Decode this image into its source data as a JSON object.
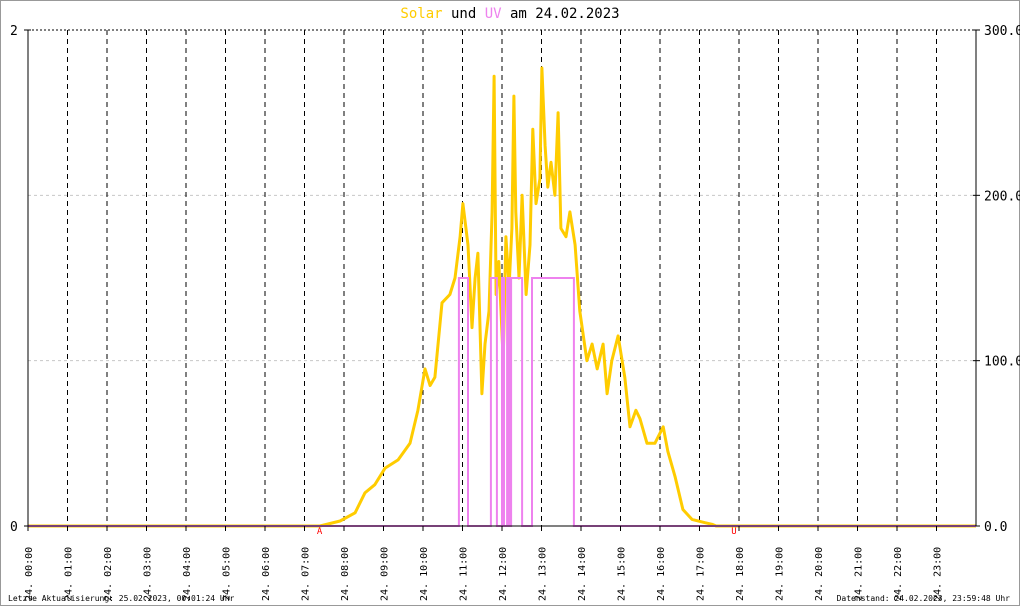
{
  "chart_data": {
    "type": "line",
    "title": {
      "part1": "Solar",
      "part2": " und ",
      "part3": "UV",
      "part4": " am 24.02.2023"
    },
    "x_range_hours": [
      0,
      24
    ],
    "x_tick_labels": [
      "24. 00:00",
      "24. 01:00",
      "24. 02:00",
      "24. 03:00",
      "24. 04:00",
      "24. 05:00",
      "24. 06:00",
      "24. 07:00",
      "24. 08:00",
      "24. 09:00",
      "24. 10:00",
      "24. 11:00",
      "24. 12:00",
      "24. 13:00",
      "24. 14:00",
      "24. 15:00",
      "24. 16:00",
      "24. 17:00",
      "24. 18:00",
      "24. 19:00",
      "24. 20:00",
      "24. 21:00",
      "24. 22:00",
      "24. 23:00"
    ],
    "left_axis": {
      "label": "UV",
      "ylim": [
        0,
        2
      ],
      "ticks": [
        "0",
        "2"
      ]
    },
    "right_axis": {
      "label": "Solar",
      "ylim": [
        0,
        300
      ],
      "ticks": [
        "0.0",
        "100.0",
        "200.0",
        "300.0"
      ]
    },
    "grid": true,
    "colors": {
      "solar": "#ffcc00",
      "uv": "#ee82ee",
      "title": "#000000",
      "marker": "#ff0000"
    },
    "markers": [
      {
        "label": "A",
        "hour": 7.39
      },
      {
        "label": "U",
        "hour": 17.88
      }
    ],
    "series": [
      {
        "name": "Solar",
        "axis": "right",
        "points": [
          [
            0,
            0
          ],
          [
            7.39,
            0
          ],
          [
            7.9,
            3
          ],
          [
            8.28,
            8
          ],
          [
            8.53,
            20
          ],
          [
            8.78,
            25
          ],
          [
            9.04,
            35
          ],
          [
            9.37,
            40
          ],
          [
            9.67,
            50
          ],
          [
            9.87,
            70
          ],
          [
            10.05,
            95
          ],
          [
            10.18,
            85
          ],
          [
            10.3,
            90
          ],
          [
            10.48,
            135
          ],
          [
            10.68,
            140
          ],
          [
            10.81,
            150
          ],
          [
            10.94,
            175
          ],
          [
            11.01,
            195
          ],
          [
            11.14,
            170
          ],
          [
            11.24,
            120
          ],
          [
            11.32,
            150
          ],
          [
            11.39,
            165
          ],
          [
            11.49,
            80
          ],
          [
            11.57,
            110
          ],
          [
            11.67,
            130
          ],
          [
            11.75,
            190
          ],
          [
            11.8,
            272
          ],
          [
            11.85,
            140
          ],
          [
            11.92,
            160
          ],
          [
            12.03,
            100
          ],
          [
            12.1,
            175
          ],
          [
            12.18,
            145
          ],
          [
            12.25,
            180
          ],
          [
            12.3,
            260
          ],
          [
            12.35,
            190
          ],
          [
            12.43,
            150
          ],
          [
            12.51,
            200
          ],
          [
            12.61,
            140
          ],
          [
            12.71,
            170
          ],
          [
            12.78,
            240
          ],
          [
            12.86,
            195
          ],
          [
            12.96,
            210
          ],
          [
            13.01,
            277
          ],
          [
            13.09,
            230
          ],
          [
            13.16,
            205
          ],
          [
            13.24,
            220
          ],
          [
            13.34,
            200
          ],
          [
            13.42,
            250
          ],
          [
            13.49,
            180
          ],
          [
            13.62,
            175
          ],
          [
            13.72,
            190
          ],
          [
            13.85,
            170
          ],
          [
            13.97,
            130
          ],
          [
            14.15,
            100
          ],
          [
            14.28,
            110
          ],
          [
            14.41,
            95
          ],
          [
            14.56,
            110
          ],
          [
            14.66,
            80
          ],
          [
            14.78,
            100
          ],
          [
            14.94,
            115
          ],
          [
            15.11,
            90
          ],
          [
            15.24,
            60
          ],
          [
            15.39,
            70
          ],
          [
            15.49,
            65
          ],
          [
            15.67,
            50
          ],
          [
            15.87,
            50
          ],
          [
            16.08,
            60
          ],
          [
            16.2,
            45
          ],
          [
            16.38,
            30
          ],
          [
            16.58,
            10
          ],
          [
            16.81,
            4
          ],
          [
            17.14,
            2
          ],
          [
            17.32,
            1
          ],
          [
            17.42,
            0
          ],
          [
            24,
            0
          ]
        ]
      },
      {
        "name": "UV",
        "axis": "left",
        "segments": [
          [
            10.91,
            11.14,
            1
          ],
          [
            11.72,
            11.87,
            1
          ],
          [
            12.0,
            12.05,
            1
          ],
          [
            12.13,
            12.18,
            1
          ],
          [
            12.23,
            12.51,
            1
          ],
          [
            12.76,
            13.82,
            1
          ]
        ]
      }
    ]
  },
  "footer": {
    "left": "Letzte Aktualisierung: 25.02.2023, 00:01:24 Uhr",
    "right": "Datenstand: 24.02.2023, 23:59:48 Uhr"
  }
}
